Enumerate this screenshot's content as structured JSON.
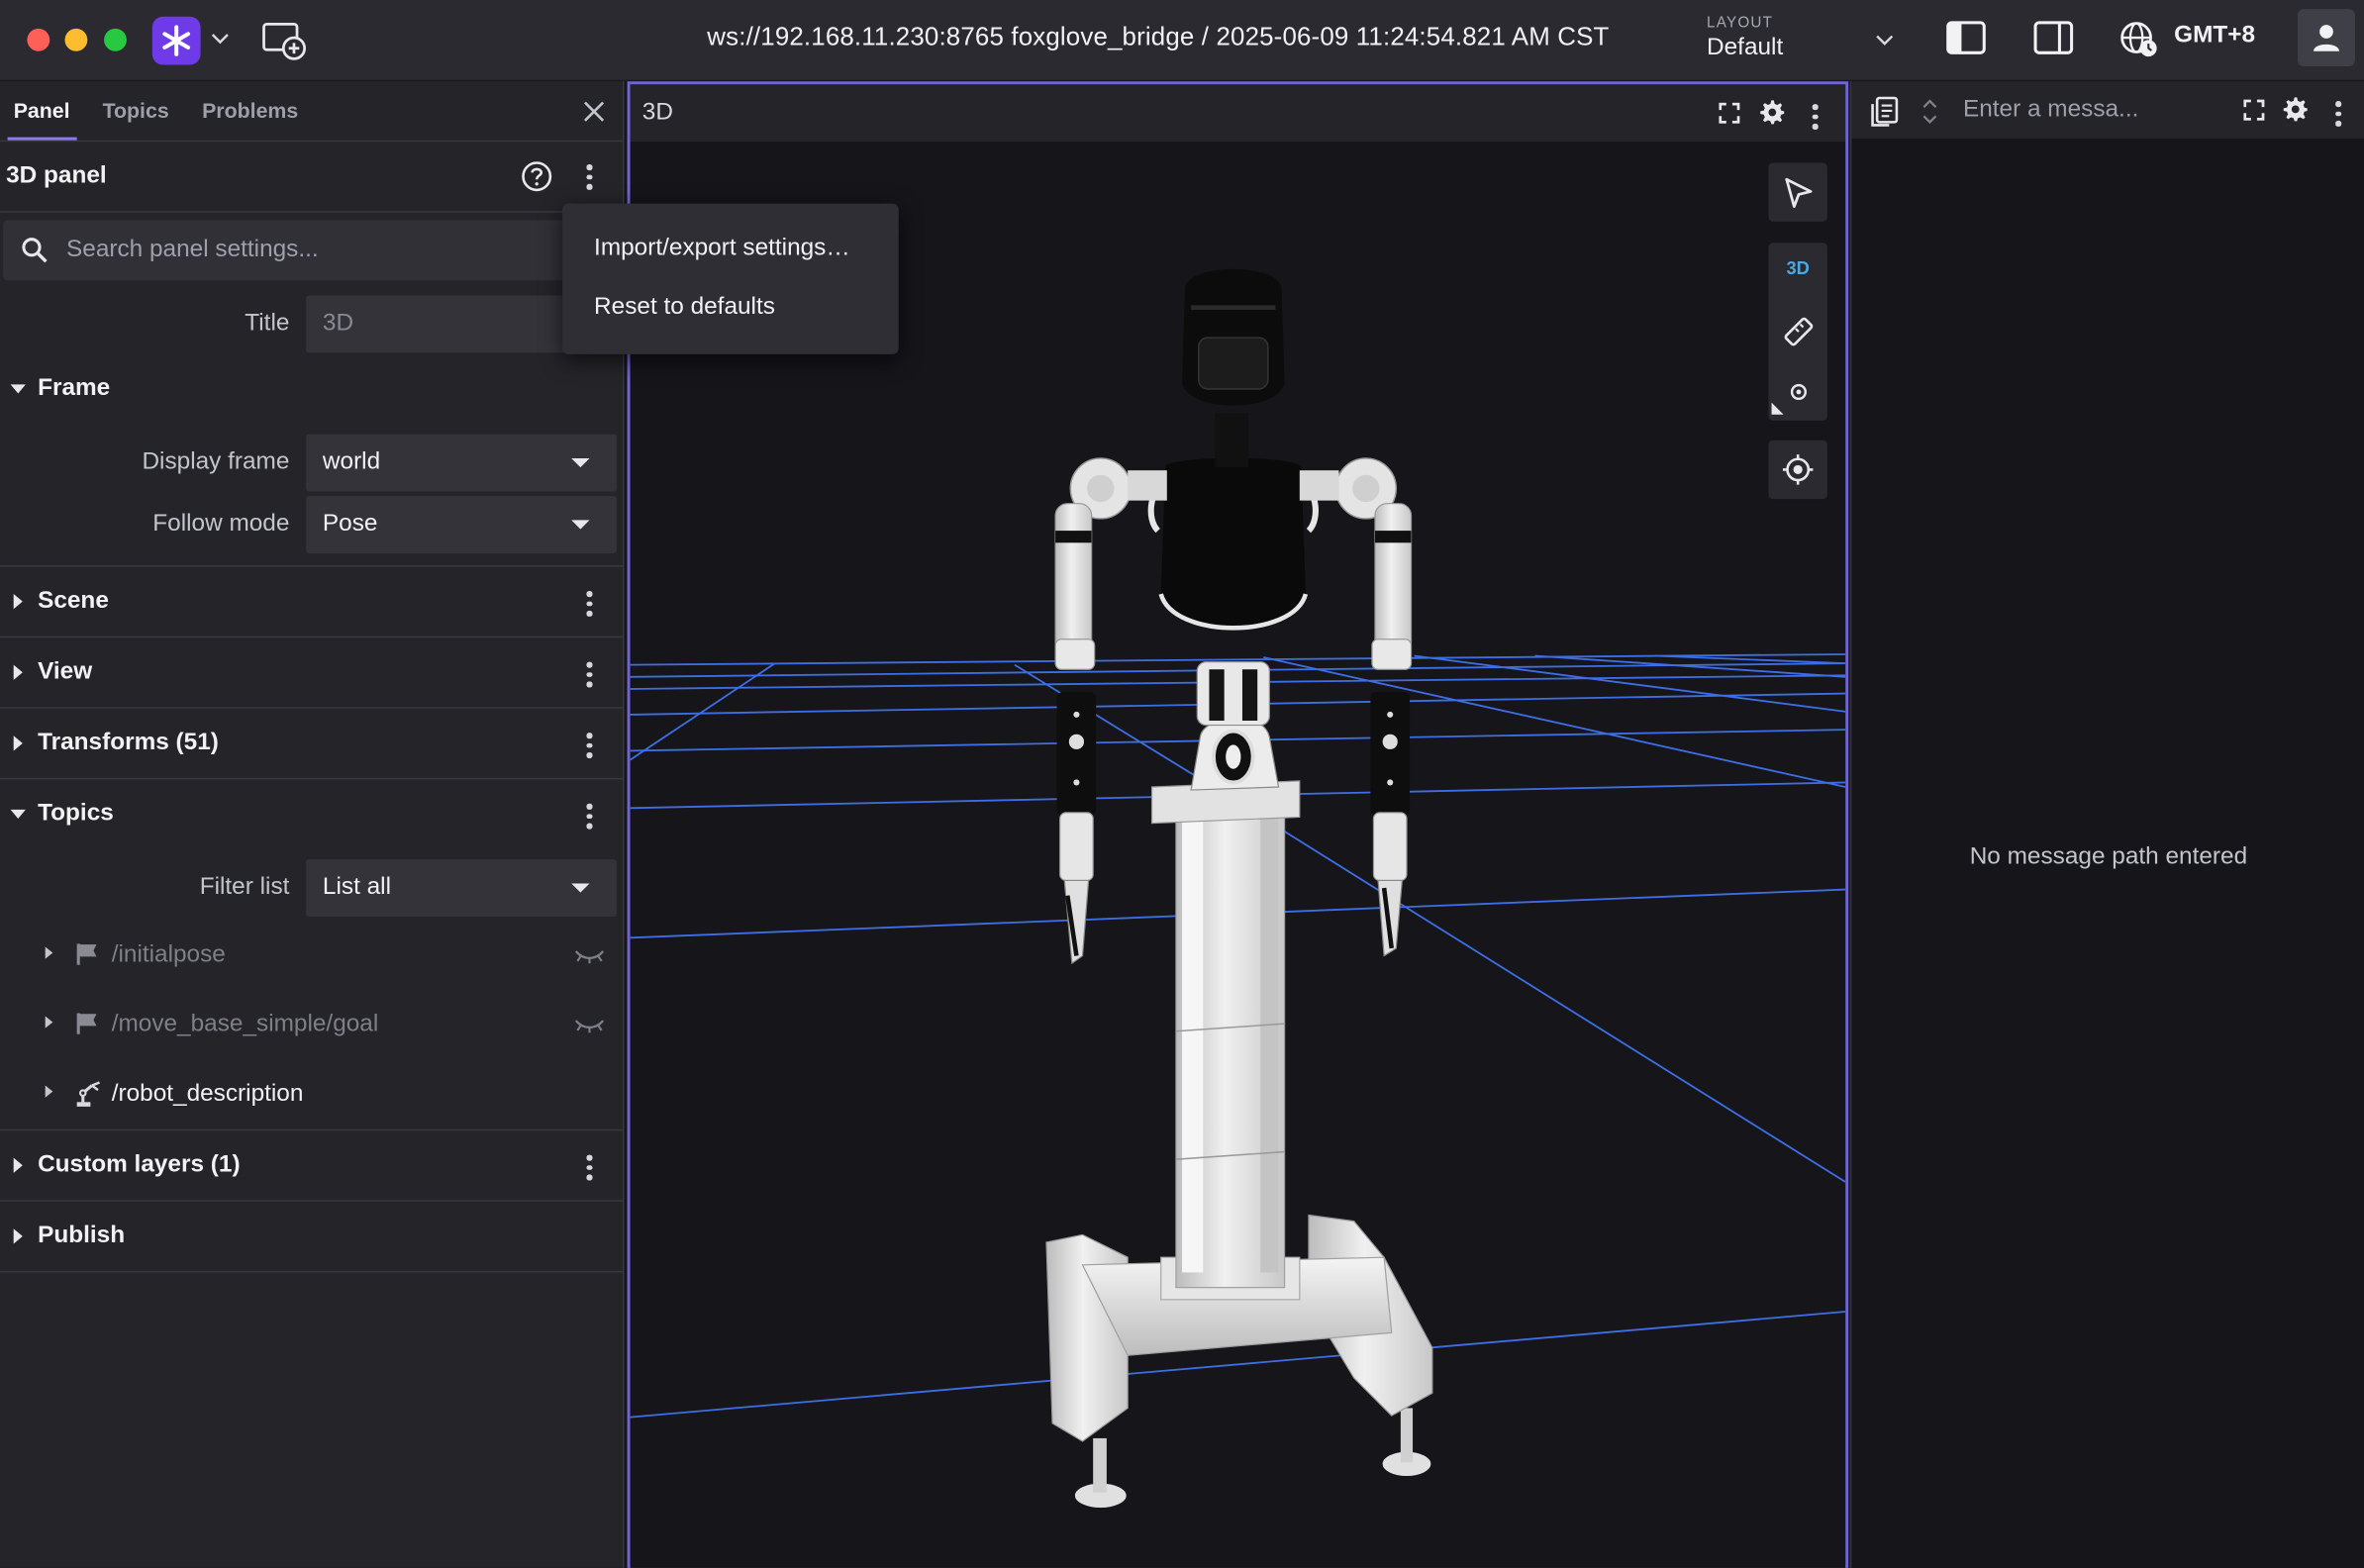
{
  "topbar": {
    "connection": "ws://192.168.11.230:8765 foxglove_bridge / 2025-06-09 11:24:54.821 AM CST",
    "layout_caption": "LAYOUT",
    "layout_value": "Default",
    "timezone": "GMT+8"
  },
  "sidebar": {
    "tabs": [
      {
        "label": "Panel",
        "active": true
      },
      {
        "label": "Topics",
        "active": false
      },
      {
        "label": "Problems",
        "active": false
      }
    ],
    "panel_title": "3D panel",
    "search_placeholder": "Search panel settings...",
    "title_field": {
      "label": "Title",
      "value": "3D"
    },
    "sections": {
      "frame": {
        "label": "Frame"
      },
      "display_frame": {
        "label": "Display frame",
        "value": "world"
      },
      "follow_mode": {
        "label": "Follow mode",
        "value": "Pose"
      },
      "scene": {
        "label": "Scene"
      },
      "view": {
        "label": "View"
      },
      "transforms": {
        "label": "Transforms (51)"
      },
      "topics": {
        "label": "Topics"
      },
      "filter_list": {
        "label": "Filter list",
        "value": "List all"
      },
      "custom_layers": {
        "label": "Custom layers (1)"
      },
      "publish": {
        "label": "Publish"
      }
    },
    "topics": [
      {
        "name": "/initialpose",
        "visible": false,
        "icon": "flag-icon"
      },
      {
        "name": "/move_base_simple/goal",
        "visible": false,
        "icon": "flag-icon"
      },
      {
        "name": "/robot_description",
        "visible": true,
        "icon": "robot-arm-icon"
      }
    ]
  },
  "menu": {
    "items": [
      "Import/export settings…",
      "Reset to defaults"
    ]
  },
  "panel3d": {
    "title": "3D",
    "toolbar": {
      "mode_label": "3D"
    }
  },
  "rightpanel": {
    "input_placeholder": "Enter a messa...",
    "empty_text": "No message path entered"
  },
  "colors": {
    "accent": "#6f3be8",
    "panel_border": "#6f66d4",
    "grid": "#3d6ee6",
    "toolbar_active": "#4aa8e8"
  }
}
